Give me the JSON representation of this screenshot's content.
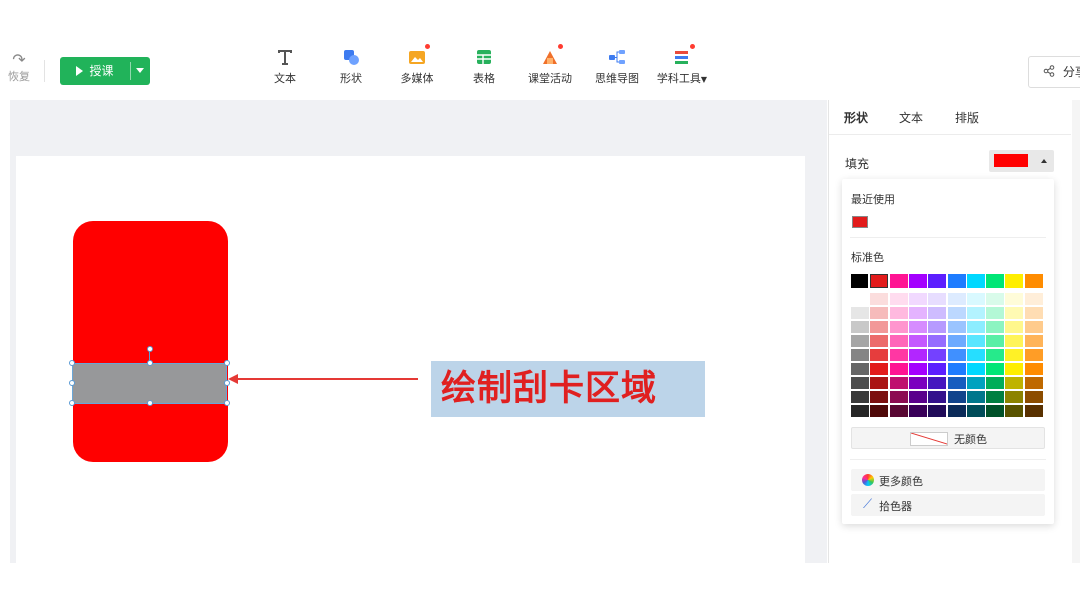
{
  "toolbar": {
    "redo_label": "恢复",
    "teach_label": "授课",
    "tools": [
      {
        "name": "text",
        "label": "文本",
        "icon": "text-icon",
        "color": "#555555"
      },
      {
        "name": "shape",
        "label": "形状",
        "icon": "shape-icon",
        "color": "#3d7bf0"
      },
      {
        "name": "media",
        "label": "多媒体",
        "icon": "media-icon",
        "color": "#f5a623"
      },
      {
        "name": "table",
        "label": "表格",
        "icon": "table-icon",
        "color": "#27b15c"
      },
      {
        "name": "activity",
        "label": "课堂活动",
        "icon": "activity-icon",
        "color": "#f0702a"
      },
      {
        "name": "mindmap",
        "label": "思维导图",
        "icon": "mindmap-icon",
        "color": "#3d7bf0"
      },
      {
        "name": "subject",
        "label": "学科工具",
        "icon": "subject-tools-icon",
        "color": "#e94b3c"
      }
    ],
    "share_label": "分享"
  },
  "canvas": {
    "card_color": "#ff0000",
    "scratch_color": "#97989a",
    "annotation_text": "绘制刮卡区域"
  },
  "panel": {
    "tabs": [
      "形状",
      "文本",
      "排版"
    ],
    "fill_label": "填充",
    "fill_color": "#ff0000",
    "popup": {
      "recent_label": "最近使用",
      "recent_color": "#e21b1b",
      "standard_label": "标准色",
      "standard_colors": [
        "#000000",
        "#e21b1b",
        "#ff1493",
        "#a400ff",
        "#5c1fff",
        "#1e7cff",
        "#00d8ff",
        "#00e676",
        "#ffee00",
        "#ff8c00"
      ],
      "no_color_label": "无颜色",
      "more_colors_label": "更多颜色",
      "picker_label": "拾色器"
    }
  }
}
